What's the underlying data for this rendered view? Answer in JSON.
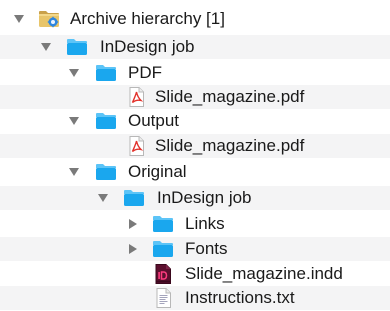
{
  "tree": {
    "rows": [
      {
        "label": "Archive hierarchy [1]",
        "icon": "archive-folder-icon",
        "expanded": true
      },
      {
        "label": "InDesign job",
        "icon": "folder-icon",
        "expanded": true
      },
      {
        "label": "PDF",
        "icon": "folder-icon",
        "expanded": true
      },
      {
        "label": "Slide_magazine.pdf",
        "icon": "pdf-file-icon"
      },
      {
        "label": "Output",
        "icon": "folder-icon",
        "expanded": true
      },
      {
        "label": "Slide_magazine.pdf",
        "icon": "pdf-file-icon"
      },
      {
        "label": "Original",
        "icon": "folder-icon",
        "expanded": true
      },
      {
        "label": "InDesign job",
        "icon": "folder-icon",
        "expanded": true
      },
      {
        "label": "Links",
        "icon": "folder-icon",
        "expanded": false
      },
      {
        "label": "Fonts",
        "icon": "folder-icon",
        "expanded": false
      },
      {
        "label": "Slide_magazine.indd",
        "icon": "indesign-file-icon"
      },
      {
        "label": "Instructions.txt",
        "icon": "text-file-icon"
      }
    ]
  },
  "colors": {
    "folder": "#1aa7ee",
    "folder_tab": "#5cc4f7",
    "pdf_red": "#e2312b",
    "indesign": "#5c0f2e",
    "indesign_text": "#ff3b7f",
    "twisty": "#7a7a7a",
    "stripe": "#f4f4f5"
  }
}
